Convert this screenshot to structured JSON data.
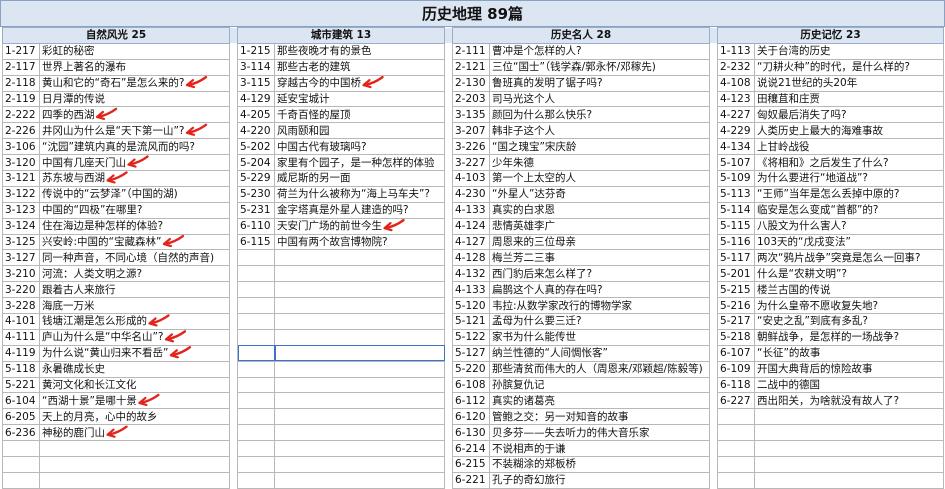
{
  "title": "历史地理 89篇",
  "accent_arrow_color": "#e3241b",
  "header_color": "#dce6f2",
  "columns": [
    {
      "header": "自然风光 25",
      "rows": [
        [
          "1-217",
          "彩虹的秘密"
        ],
        [
          "2-117",
          "世界上著名的瀑布"
        ],
        [
          "2-118",
          "黄山和它的“奇石”是怎么来的?"
        ],
        [
          "2-119",
          "日月潭的传说"
        ],
        [
          "2-222",
          "四季的西湖"
        ],
        [
          "2-226",
          "井冈山为什么是“天下第一山”?"
        ],
        [
          "3-106",
          "“沈园”建筑内真的是流风而的吗?"
        ],
        [
          "3-120",
          "中国有几座天门山"
        ],
        [
          "3-121",
          "苏东坡与西湖"
        ],
        [
          "3-122",
          "传说中的“云梦泽”（中国的湖)"
        ],
        [
          "3-123",
          "中国的“四极”在哪里?"
        ],
        [
          "3-124",
          "住在海边是种怎样的体验?"
        ],
        [
          "3-125",
          "兴安岭:中国的“宝藏森林”"
        ],
        [
          "3-127",
          "同一种声音，不同心境（自然的声音)"
        ],
        [
          "3-210",
          "河流：人类文明之源?"
        ],
        [
          "3-220",
          "跟着古人来旅行"
        ],
        [
          "3-228",
          "海底一万米"
        ],
        [
          "4-101",
          "钱塘江潮是怎么形成的"
        ],
        [
          "4-111",
          "庐山为什么是“中华名山”?"
        ],
        [
          "4-119",
          "为什么说“黄山归来不看岳”"
        ],
        [
          "5-118",
          "永暑礁成长史"
        ],
        [
          "5-221",
          "黄河文化和长江文化"
        ],
        [
          "6-104",
          "“西湖十景”是哪十景"
        ],
        [
          "6-205",
          "天上的月亮，心中的故乡"
        ],
        [
          "6-236",
          "神秘的鹿门山"
        ]
      ]
    },
    {
      "header": "城市建筑 13",
      "rows": [
        [
          "1-215",
          "那些夜晚才有的景色"
        ],
        [
          "3-114",
          "那些古老的建筑"
        ],
        [
          "3-115",
          "穿越古今的中国桥"
        ],
        [
          "4-129",
          "延安宝城计"
        ],
        [
          "4-205",
          "千奇百怪的屋顶"
        ],
        [
          "4-220",
          "风雨颐和园"
        ],
        [
          "5-202",
          "中国古代有玻璃吗?"
        ],
        [
          "5-204",
          "家里有个园子，是一种怎样的体验"
        ],
        [
          "5-229",
          "威尼斯的另一面"
        ],
        [
          "5-230",
          "荷兰为什么被称为“海上马车夫”?"
        ],
        [
          "5-231",
          "金字塔真是外星人建造的吗?"
        ],
        [
          "6-110",
          "天安门广场的前世今生"
        ],
        [
          "6-115",
          "中国有两个故宫博物院?"
        ]
      ]
    },
    {
      "header": "历史名人 28",
      "rows": [
        [
          "2-111",
          "曹冲是个怎样的人?"
        ],
        [
          "2-121",
          "三位“国士”（钱学森/郭永怀/邓稼先)"
        ],
        [
          "2-130",
          "鲁班真的发明了锯子吗?"
        ],
        [
          "2-203",
          "司马光这个人"
        ],
        [
          "3-135",
          "颜回为什么那么快乐?"
        ],
        [
          "3-207",
          "韩非子这个人"
        ],
        [
          "3-226",
          "“国之瑰宝”宋庆龄"
        ],
        [
          "3-227",
          "少年朱德"
        ],
        [
          "4-103",
          "第一个上太空的人"
        ],
        [
          "4-230",
          "“外星人”达芬奇"
        ],
        [
          "4-133",
          "真实的白求恩"
        ],
        [
          "4-124",
          "悲情英雄李广"
        ],
        [
          "4-127",
          "周恩来的三位母亲"
        ],
        [
          "4-128",
          "梅兰芳二三事"
        ],
        [
          "4-132",
          "西门豹后来怎么样了?"
        ],
        [
          "4-133",
          "扁鹊这个人真的存在吗?"
        ],
        [
          "5-120",
          "韦拉:从数学家改行的博物学家"
        ],
        [
          "5-121",
          "孟母为什么要三迁?"
        ],
        [
          "5-122",
          "家书为什么能传世"
        ],
        [
          "5-127",
          "纳兰性德的“人间惆怅客”"
        ],
        [
          "5-220",
          "那些清贫而伟大的人（周恩来/邓颖超/陈毅等)"
        ],
        [
          "6-108",
          "孙膑复仇记"
        ],
        [
          "6-112",
          "真实的诸葛亮"
        ],
        [
          "6-120",
          "管鲍之交：另一对知音的故事"
        ],
        [
          "6-130",
          "贝多芬——失去听力的伟大音乐家"
        ],
        [
          "6-214",
          "不说相声的于谦"
        ],
        [
          "6-215",
          "不装糊涂的郑板桥"
        ],
        [
          "6-221",
          "孔子的奇幻旅行"
        ]
      ]
    },
    {
      "header": "历史记忆 23",
      "rows": [
        [
          "1-113",
          "关于台湾的历史"
        ],
        [
          "2-232",
          "“刀耕火种”的时代，是什么样的?"
        ],
        [
          "4-108",
          "说说21世纪的头20年"
        ],
        [
          "4-123",
          "田穰苴和庄贾"
        ],
        [
          "4-227",
          "匈奴最后消失了吗?"
        ],
        [
          "4-229",
          "人类历史上最大的海难事故"
        ],
        [
          "4-134",
          "上甘岭战役"
        ],
        [
          "5-107",
          "《将相和》之后发生了什么?"
        ],
        [
          "5-109",
          "为什么要进行“地道战”?"
        ],
        [
          "5-113",
          "“王师”当年是怎么丢掉中原的?"
        ],
        [
          "5-114",
          "临安是怎么变成“首都”的?"
        ],
        [
          "5-115",
          "八股文为什么害人?"
        ],
        [
          "5-116",
          "103天的“戊戌变法”"
        ],
        [
          "5-117",
          "两次“鸦片战争”突竟是怎么一回事?"
        ],
        [
          "5-201",
          "什么是“农耕文明”?"
        ],
        [
          "5-215",
          "楼兰古国的传说"
        ],
        [
          "5-216",
          "为什么皇帝不愿收复失地?"
        ],
        [
          "5-217",
          "“安史之乱”到底有多乱?"
        ],
        [
          "5-218",
          "朝鲜战争，是怎样的一场战争?"
        ],
        [
          "6-107",
          "“长征”的故事"
        ],
        [
          "6-109",
          "开国大典背后的惊险故事"
        ],
        [
          "6-118",
          "二战中的德国"
        ],
        [
          "6-227",
          "西出阳关，为啥就没有故人了?"
        ]
      ]
    }
  ]
}
